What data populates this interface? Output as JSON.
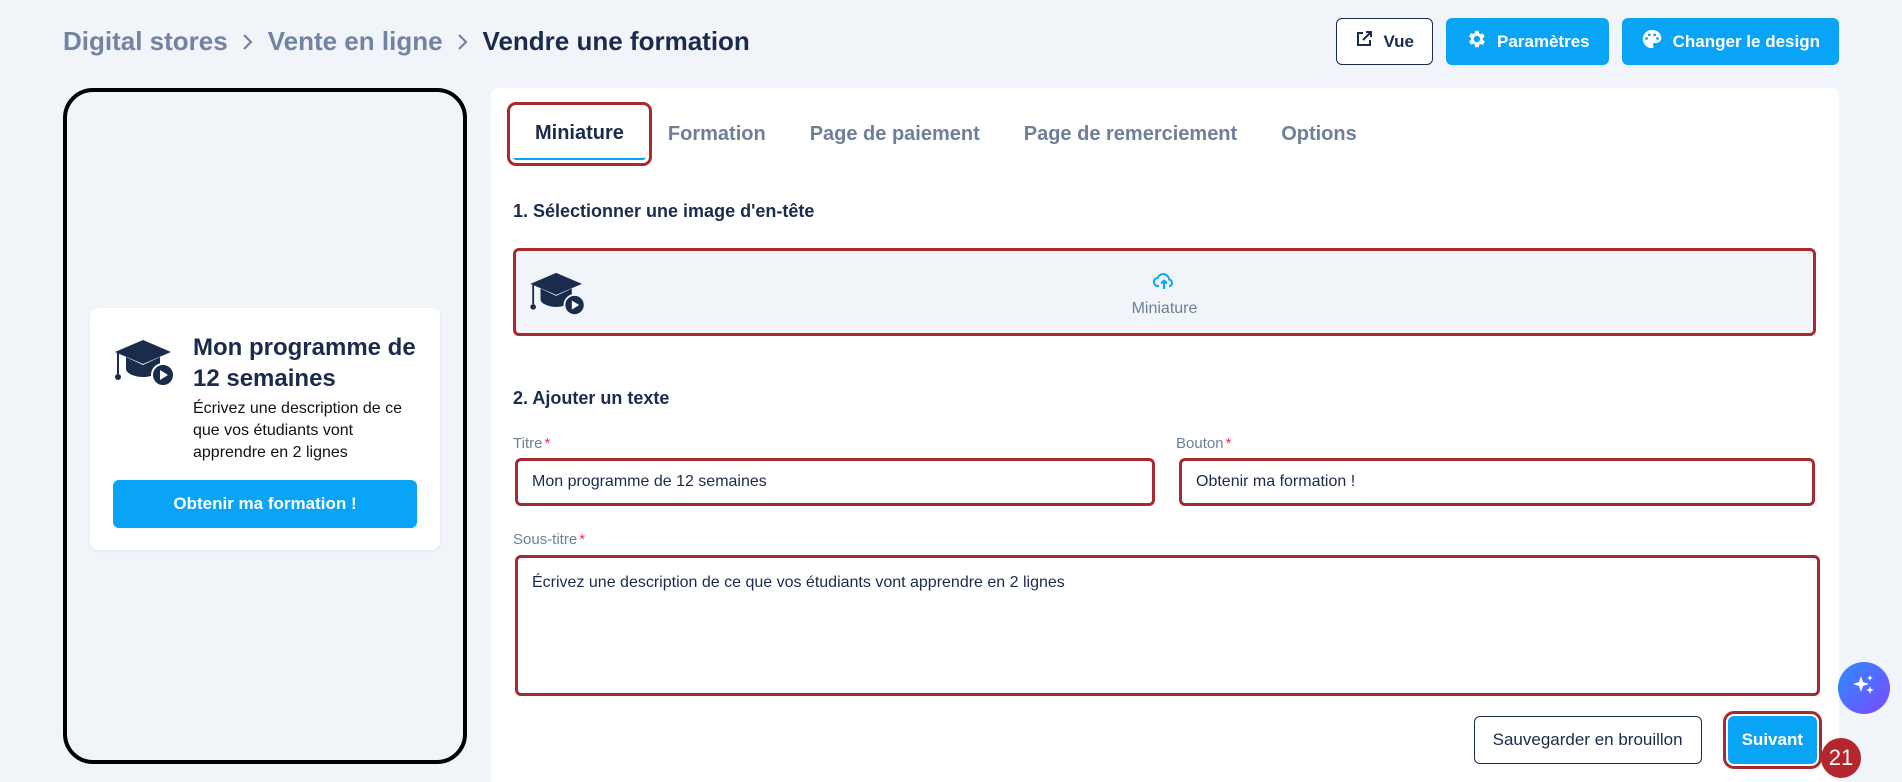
{
  "breadcrumb": {
    "items": [
      "Digital stores",
      "Vente en ligne",
      "Vendre une formation"
    ]
  },
  "header": {
    "view_label": "Vue",
    "settings_label": "Paramètres",
    "design_label": "Changer le design"
  },
  "preview": {
    "title": "Mon programme de 12 semaines",
    "description": "Écrivez une description de ce que vos étudiants vont apprendre en 2 lignes",
    "button": "Obtenir ma formation !"
  },
  "tabs": [
    "Miniature",
    "Formation",
    "Page de paiement",
    "Page de remerciement",
    "Options"
  ],
  "sections": {
    "image_title": "1. Sélectionner une image d'en-tête",
    "upload_label": "Miniature",
    "text_title": "2. Ajouter un texte"
  },
  "form": {
    "title_label": "Titre",
    "title_value": "Mon programme de 12 semaines",
    "button_label": "Bouton",
    "button_value": "Obtenir ma formation !",
    "subtitle_label": "Sous-titre",
    "subtitle_value": "Écrivez une description de ce que vos étudiants vont apprendre en 2 lignes",
    "required_mark": "*"
  },
  "footer": {
    "draft_label": "Sauvegarder en brouillon",
    "next_label": "Suivant"
  },
  "step_badge": "21",
  "colors": {
    "accent": "#0aa4f6",
    "navy": "#1a2b4c",
    "highlight": "#a62a2f"
  }
}
